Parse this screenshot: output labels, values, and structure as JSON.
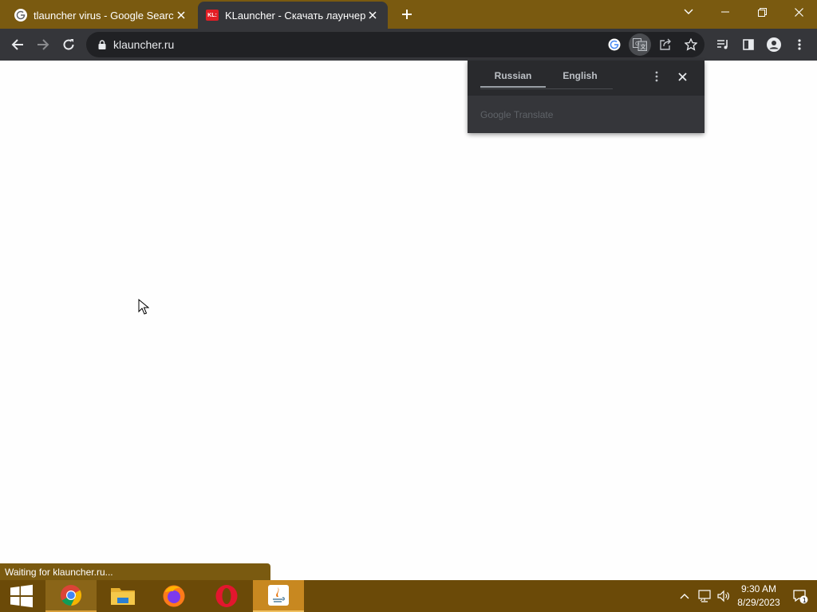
{
  "browser": {
    "tabs": [
      {
        "title": "tlauncher virus - Google Search",
        "favicon": "google-icon"
      },
      {
        "title": "KLauncher - Скачать лаунчер М...",
        "favicon": "klauncher-icon",
        "favicon_text": "KL:"
      }
    ],
    "url": "klauncher.ru",
    "status_text": "Waiting for klauncher.ru..."
  },
  "translate_popup": {
    "tabs": [
      "Russian",
      "English"
    ],
    "selected": "Russian",
    "brand": "Google Translate"
  },
  "taskbar": {
    "apps": [
      "start",
      "chrome",
      "file-explorer",
      "firefox",
      "opera",
      "java"
    ],
    "time": "9:30 AM",
    "date": "8/29/2023",
    "notification_count": "1"
  },
  "colors": {
    "tabstrip": "#7a5a10",
    "toolbar": "#35363a",
    "taskbar": "#6b4a08"
  }
}
